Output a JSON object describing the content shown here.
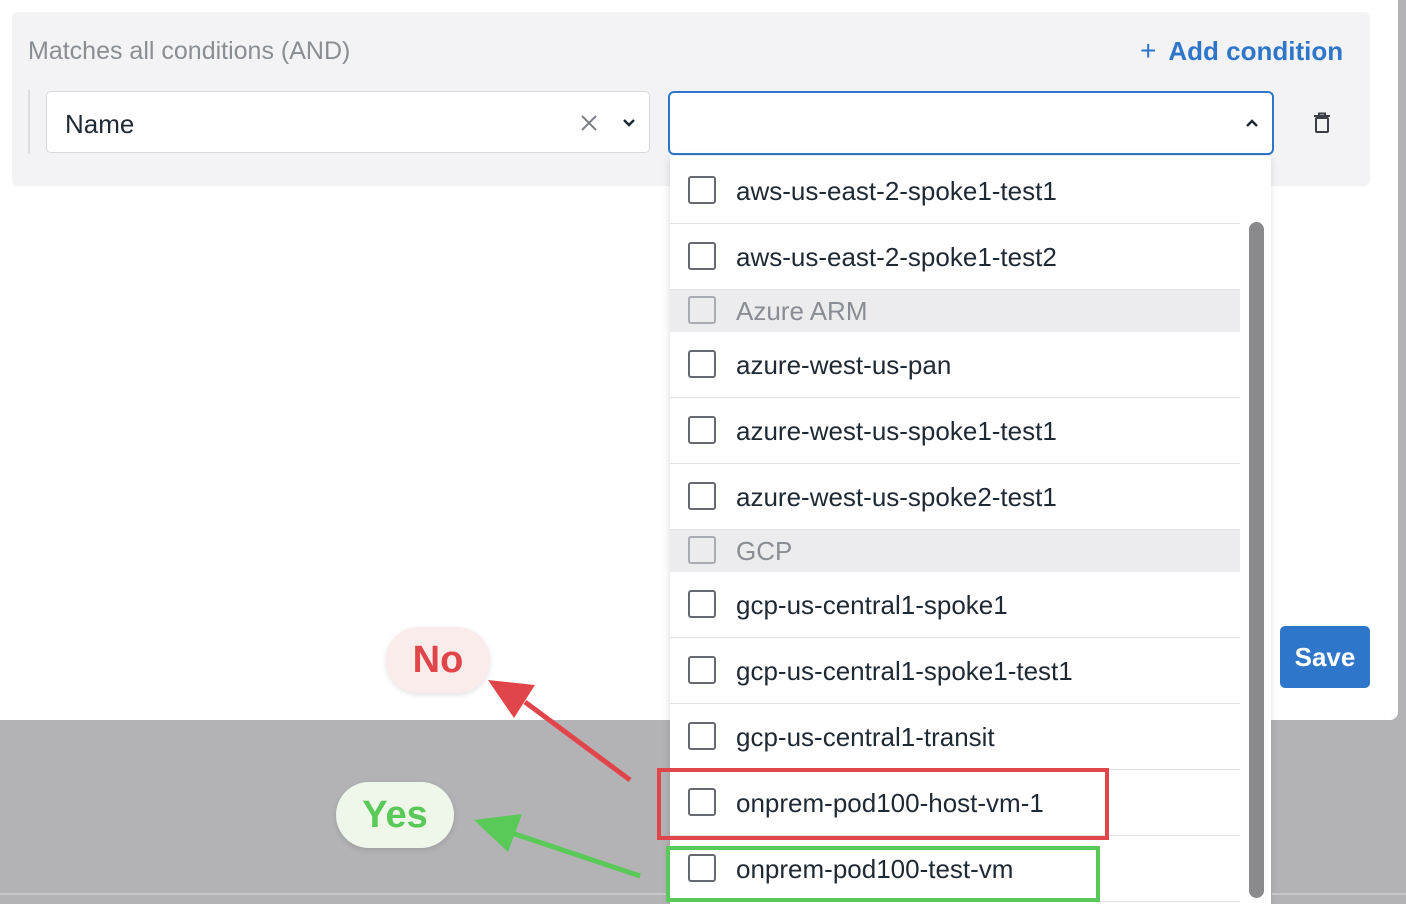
{
  "conditions": {
    "match_label": "Matches all conditions (AND)",
    "add_label": "Add condition",
    "add_icon": "+",
    "field_value": "Name",
    "value_select_value": ""
  },
  "dropdown": {
    "items": [
      {
        "label": "aws-us-east-2-spoke1-test1",
        "type": "option"
      },
      {
        "label": "aws-us-east-2-spoke1-test2",
        "type": "option"
      },
      {
        "label": "Azure ARM",
        "type": "group"
      },
      {
        "label": "azure-west-us-pan",
        "type": "option"
      },
      {
        "label": "azure-west-us-spoke1-test1",
        "type": "option"
      },
      {
        "label": "azure-west-us-spoke2-test1",
        "type": "option"
      },
      {
        "label": "GCP",
        "type": "group"
      },
      {
        "label": "gcp-us-central1-spoke1",
        "type": "option"
      },
      {
        "label": "gcp-us-central1-spoke1-test1",
        "type": "option"
      },
      {
        "label": "gcp-us-central1-transit",
        "type": "option"
      },
      {
        "label": "onprem-pod100-host-vm-1",
        "type": "option"
      },
      {
        "label": "onprem-pod100-test-vm",
        "type": "option"
      }
    ]
  },
  "actions": {
    "save_label": "Save"
  },
  "annotations": {
    "no_label": "No",
    "yes_label": "Yes",
    "no_color": "#e0454a",
    "yes_color": "#59c957"
  },
  "colors": {
    "accent": "#2e76c9"
  }
}
